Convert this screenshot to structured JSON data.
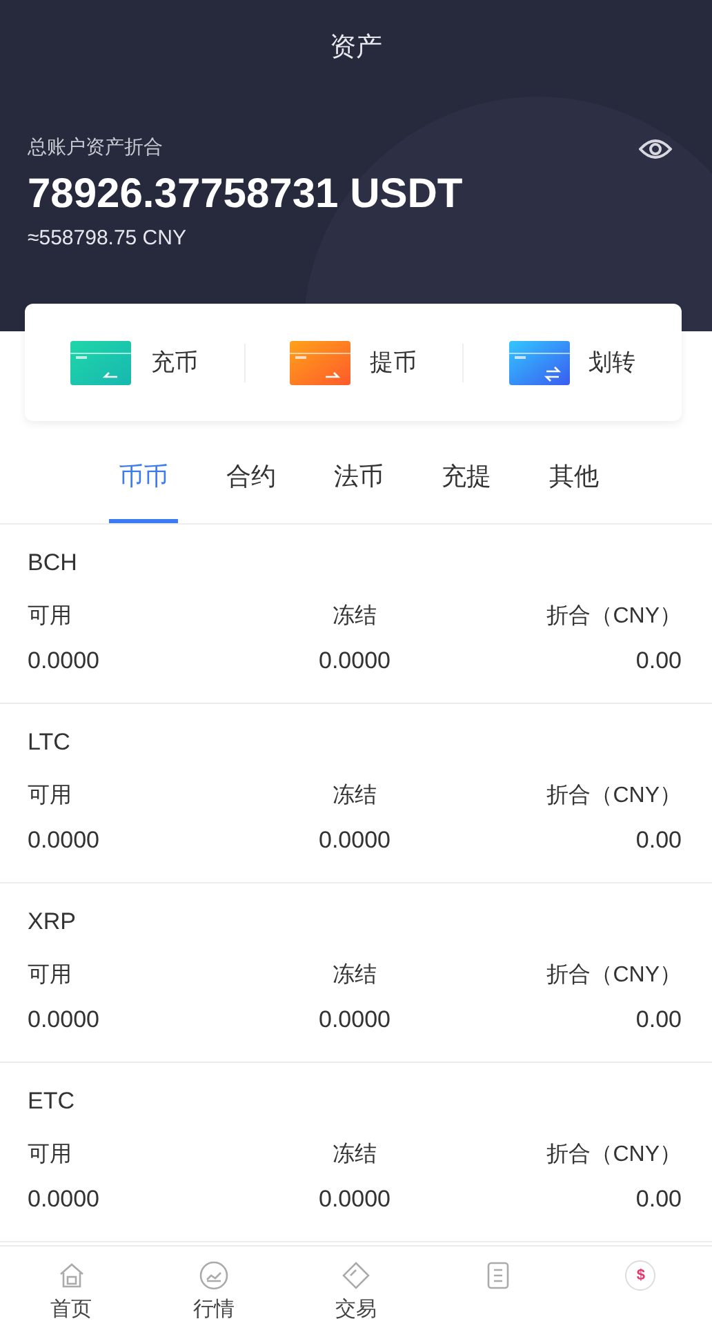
{
  "header": {
    "title": "资产"
  },
  "summary": {
    "label": "总账户资产折合",
    "total": "78926.37758731 USDT",
    "approx": "≈558798.75 CNY"
  },
  "actions": [
    {
      "kind": "deposit",
      "label": "充币"
    },
    {
      "kind": "withdraw",
      "label": "提币"
    },
    {
      "kind": "transfer",
      "label": "划转"
    }
  ],
  "tabs": [
    {
      "label": "币币",
      "selected": true
    },
    {
      "label": "合约",
      "selected": false
    },
    {
      "label": "法币",
      "selected": false
    },
    {
      "label": "充提",
      "selected": false
    },
    {
      "label": "其他",
      "selected": false
    }
  ],
  "assets": [
    {
      "coin": "BCH",
      "columns": [
        "可用",
        "冻结",
        "折合（CNY）"
      ],
      "available": "0.0000",
      "frozen": "0.0000",
      "value": "0.00"
    },
    {
      "coin": "LTC",
      "columns": [
        "可用",
        "冻结",
        "折合（CNY）"
      ],
      "available": "0.0000",
      "frozen": "0.0000",
      "value": "0.00"
    },
    {
      "coin": "XRP",
      "columns": [
        "可用",
        "冻结",
        "折合（CNY）"
      ],
      "available": "0.0000",
      "frozen": "0.0000",
      "value": "0.00"
    },
    {
      "coin": "ETC",
      "columns": [
        "可用",
        "冻结",
        "折合（CNY）"
      ],
      "available": "0.0000",
      "frozen": "0.0000",
      "value": "0.00"
    }
  ],
  "nav": [
    {
      "kind": "home",
      "label": "首页",
      "selected": false
    },
    {
      "kind": "market",
      "label": "行情",
      "selected": false
    },
    {
      "kind": "trade",
      "label": "交易",
      "selected": false
    },
    {
      "kind": "orders",
      "selected": false
    },
    {
      "kind": "assets",
      "symbol": "$",
      "selected": true
    }
  ]
}
